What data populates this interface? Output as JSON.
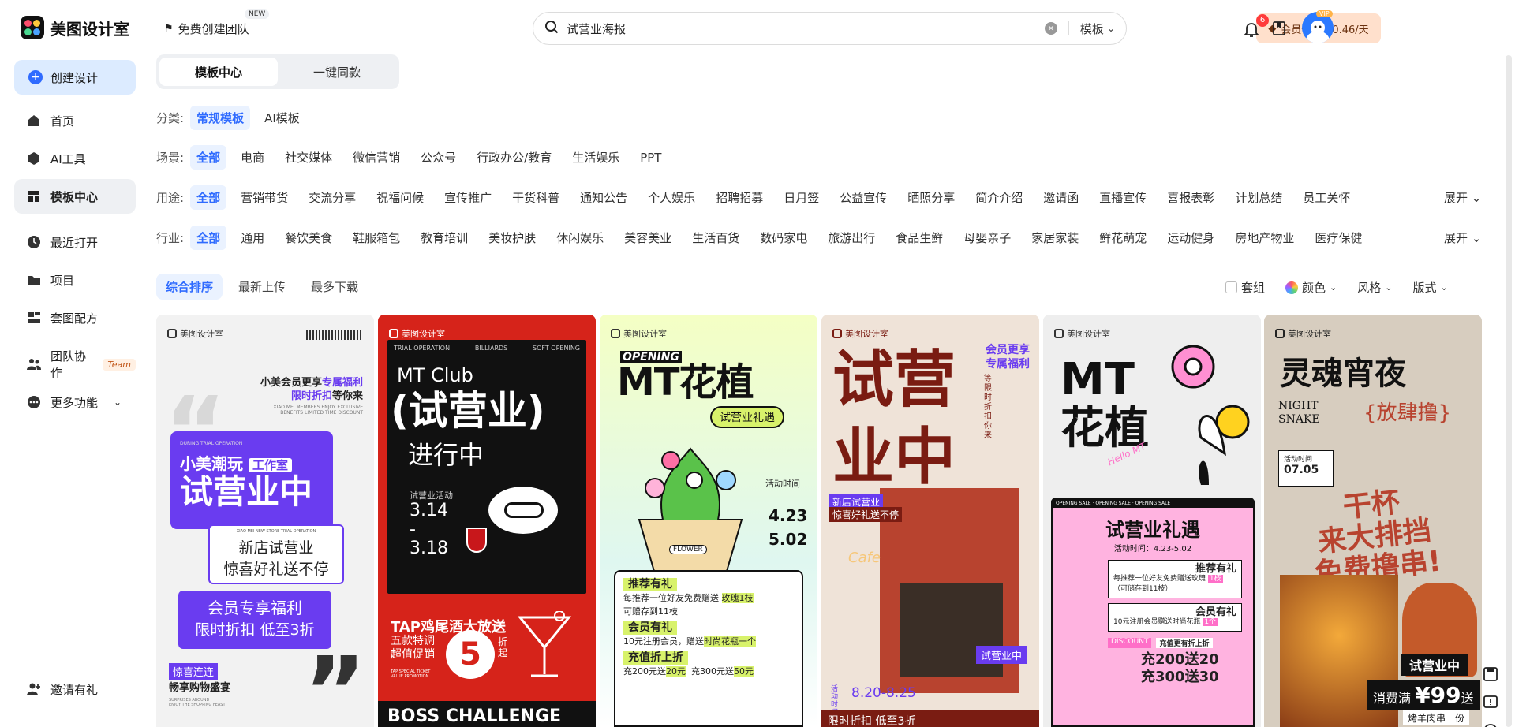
{
  "app": {
    "name": "美图设计室"
  },
  "sidebar": {
    "create": "创建设计",
    "items": [
      {
        "label": "首页",
        "icon": "home-icon"
      },
      {
        "label": "AI工具",
        "icon": "ai-icon"
      },
      {
        "label": "模板中心",
        "icon": "template-icon"
      },
      {
        "label": "最近打开",
        "icon": "clock-icon"
      },
      {
        "label": "项目",
        "icon": "folder-icon"
      },
      {
        "label": "套图配方",
        "icon": "recipe-icon"
      },
      {
        "label": "团队协作",
        "icon": "team-icon",
        "tag": "Team"
      },
      {
        "label": "更多功能",
        "icon": "more-icon"
      }
    ],
    "invite": "邀请有礼"
  },
  "topbar": {
    "team": "免费创建团队",
    "new_badge": "NEW",
    "search_value": "试营业海报",
    "scope": "模板",
    "vip": "会员低至￥0.46/天",
    "notify_count": "6",
    "vip_mini": "VIP"
  },
  "tabs": [
    "模板中心",
    "一键同款"
  ],
  "filters": {
    "category_label": "分类:",
    "category": [
      "常规模板",
      "AI模板"
    ],
    "scene_label": "场景:",
    "scene": [
      "全部",
      "电商",
      "社交媒体",
      "微信营销",
      "公众号",
      "行政办公/教育",
      "生活娱乐",
      "PPT"
    ],
    "use_label": "用途:",
    "use": [
      "全部",
      "营销带货",
      "交流分享",
      "祝福问候",
      "宣传推广",
      "干货科普",
      "通知公告",
      "个人娱乐",
      "招聘招募",
      "日月签",
      "公益宣传",
      "晒照分享",
      "简介介绍",
      "邀请函",
      "直播宣传",
      "喜报表彰",
      "计划总结",
      "员工关怀"
    ],
    "industry_label": "行业:",
    "industry": [
      "全部",
      "通用",
      "餐饮美食",
      "鞋服箱包",
      "教育培训",
      "美妆护肤",
      "休闲娱乐",
      "美容美业",
      "生活百货",
      "数码家电",
      "旅游出行",
      "食品生鲜",
      "母婴亲子",
      "家居家装",
      "鲜花萌宠",
      "运动健身",
      "房地产物业",
      "医疗保健"
    ],
    "expand": "展开"
  },
  "sort": [
    "综合排序",
    "最新上传",
    "最多下载"
  ],
  "right_filters": {
    "set": "套组",
    "color": "颜色",
    "style": "风格",
    "format": "版式"
  },
  "cards": {
    "brand": "美图设计室",
    "c1": {
      "l1": "小美会员更享",
      "l1b": "专属福利",
      "l2": "限时折扣",
      "l2b": "等你来",
      "en1": "XIAO MEI MEMBERS ENJOY EXCLUSIVE",
      "en2": "BENEFITS LIMITED TIME DISCOUNT",
      "sub": "DURING TRIAL OPERATION",
      "brand2": "小美潮玩",
      "tag": "工作室",
      "big": "试营业中",
      "en3": "XIAO MEI NEW STORE TRIAL OPERATION",
      "b1": "新店试营业",
      "b2": "惊喜好礼送不停",
      "p1": "会员专享福利",
      "p2": "限时折扣 低至3折",
      "t1": "惊喜连连",
      "t2": "畅享购物盛宴",
      "en4": "SURPRISES ABOUND",
      "en5": "ENJOY THE SHOPPING FEAST"
    },
    "c2": {
      "top1": "TRIAL OPERATION",
      "top2": "BILLIARDS",
      "top3": "SOFT OPENING",
      "club": "MT Club",
      "big": "(试营业)",
      "sub": "进行中",
      "act": "试营业活动",
      "d1": "3.14",
      "dash": "-",
      "d2": "3.18",
      "tap": "TAP鸡尾酒大放送",
      "w1": "五款特调",
      "w2": "超值促销",
      "num": "5",
      "zhe": "折",
      "qi": "起",
      "en": "TAP SPECIAL TICKET VALUE PROMOTION",
      "bottom": "BOSS CHALLENGE"
    },
    "c3": {
      "opening": "OPENING",
      "title": "MT花植",
      "tag": "试营业礼遇",
      "time": "活动时间",
      "d1": "4.23",
      "d2": "5.02",
      "flower": "FLOWER",
      "s1": "推荐有礼",
      "s1a": "每推荐一位好友免费赠送",
      "s1b": "玫瑰1枝",
      "s1c": "可赠存到11枝",
      "s2": "会员有礼",
      "s2a": "10元注册会员，赠送",
      "s2b": "时尚花瓶一个",
      "s3": "充值折上折",
      "s3a": "充200元送",
      "s3b": "20元",
      "s3c": "充300元送",
      "s3d": "50元"
    },
    "c4": {
      "big1": "试营",
      "big2": "业中",
      "vip1": "会员更享",
      "vip2": "专属福利",
      "side": "等限时折扣你来",
      "shop1": "新店试营业",
      "shop2": "惊喜好礼送不停",
      "cafe": "Cafe",
      "badge": "试营业中",
      "time": "活动时间",
      "date": "8.20-8.25",
      "bottom": "限时折扣 低至3折"
    },
    "c5": {
      "t1": "MT",
      "t2": "花植",
      "hello": "Hello MT",
      "ribbon": "OPENING SALE · OPENING SALE · OPENING SALE",
      "title": "试营业礼遇",
      "date": "活动时间：4.23-5.02",
      "r1": "推荐有礼",
      "r1a": "每推荐一位好友免费赠送玫瑰",
      "r1b": "1枝",
      "r1c": "（可储存到11枝）",
      "r2": "会员有礼",
      "r2a": "10元注册会员赠送时尚花瓶",
      "r2b": "1个",
      "disc": "DISCOUNT",
      "disc2": "充值更有折上折",
      "c1": "充200送20",
      "c2": "充300送30"
    },
    "c6": {
      "title": "灵魂宵夜",
      "en1": "NIGHT",
      "en2": "SNAKE",
      "sub": "{放肆撸}",
      "time": "活动时间",
      "date": "07.05",
      "s1": "干杯",
      "s2": "来大排挡",
      "s3": "免费撸串!",
      "badge": "试营业中",
      "price1": "消费满",
      "price2": "¥99",
      "price3": "送",
      "foot": "烤羊肉串一份"
    }
  },
  "colors": {
    "accent": "#2f6bff",
    "vip_bg": "#ffe0cc",
    "red": "#d6231a",
    "purple": "#6a3cf0"
  }
}
